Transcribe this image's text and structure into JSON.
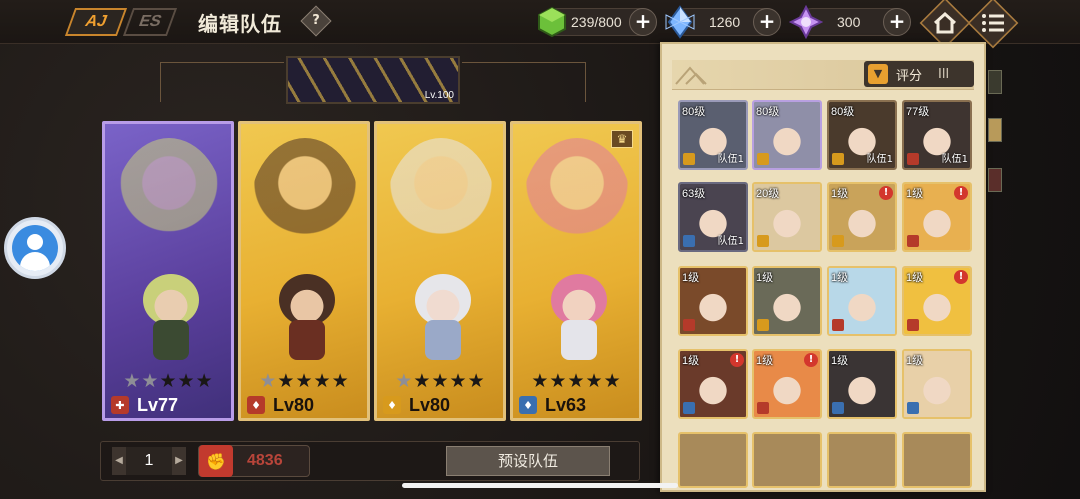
{
  "header": {
    "logo_mark_1": "AJ",
    "logo_mark_2": "ES",
    "title": "编辑队伍",
    "help_glyph": "?",
    "resources": [
      {
        "name": "stamina",
        "value": "239/800",
        "icon": "green-cube-icon",
        "color": "#6cc03a"
      },
      {
        "name": "crystal",
        "value": "1260",
        "icon": "blue-crystal-icon",
        "color": "#7db6ff"
      },
      {
        "name": "gem",
        "value": "300",
        "icon": "purple-gem-icon",
        "color": "#c692f2"
      }
    ],
    "plus_glyph": "+",
    "home_icon": "home-icon",
    "menu_icon": "menu-icon"
  },
  "boss_banner": {
    "level": "Lv.100"
  },
  "team_cards": [
    {
      "level": "Lv77",
      "stars_on": 2,
      "stars_total": 5,
      "theme": "purple",
      "role_color": "#b53a2a",
      "role_glyph": "✚",
      "hair": "#c9d07a",
      "skin": "#e9cdb0",
      "outfit": "#3b4a32"
    },
    {
      "level": "Lv80",
      "stars_on": 1,
      "stars_total": 5,
      "theme": "gold",
      "role_color": "#b53a2a",
      "role_glyph": "♦",
      "hair": "#4a3024",
      "skin": "#e9c6a5",
      "outfit": "#6a2f22"
    },
    {
      "level": "Lv80",
      "stars_on": 1,
      "stars_total": 5,
      "theme": "gold",
      "role_color": "#d79a1d",
      "role_glyph": "♦",
      "hair": "#e6e6ea",
      "skin": "#f0dbd0",
      "outfit": "#9aa9c8"
    },
    {
      "level": "Lv63",
      "stars_on": 0,
      "stars_total": 5,
      "theme": "gold",
      "role_color": "#3a6fb0",
      "role_glyph": "♦",
      "hair": "#e07aa0",
      "skin": "#f1d2c0",
      "outfit": "#e4e4ea",
      "crown": true
    }
  ],
  "star_glyph": "★",
  "crown_glyph": "♛",
  "bottom": {
    "page_prev": "◀",
    "page_number": "1",
    "page_next": "▶",
    "power_icon": "fist-icon",
    "power_glyph": "✊",
    "power_value": "4836",
    "preset_label": "预设队伍"
  },
  "roster": {
    "sort_label": "评分",
    "sort_filter_glyph": "▼",
    "sort_bars_glyph": "Ill",
    "slots": [
      {
        "level": "80级",
        "team": "队伍1",
        "border": "#9a9ab8",
        "bg": "#5a5f70",
        "cls": "#d79a1d"
      },
      {
        "level": "80级",
        "team": "",
        "border": "#b8a0e0",
        "bg": "#8f8fa8",
        "cls": "#d79a1d"
      },
      {
        "level": "80级",
        "team": "队伍1",
        "border": "#8a7050",
        "bg": "#4a3a2c",
        "cls": "#d79a1d"
      },
      {
        "level": "77级",
        "team": "队伍1",
        "border": "#8a7050",
        "bg": "#3e3430",
        "cls": "#b53a2a"
      },
      {
        "level": "63级",
        "team": "队伍1",
        "border": "#6a6a80",
        "bg": "#4a4450",
        "cls": "#3a6fb0"
      },
      {
        "level": "20级",
        "team": "",
        "border": "#e6c16a",
        "bg": "#dcc8a0",
        "cls": "#d79a1d"
      },
      {
        "level": "1级",
        "team": "",
        "border": "#e6c16a",
        "bg": "#c9a35a",
        "cls": "#d79a1d",
        "alert": true
      },
      {
        "level": "1级",
        "team": "",
        "border": "#e6c16a",
        "bg": "#e8b050",
        "cls": "#b53a2a",
        "alert": true
      },
      {
        "level": "1级",
        "team": "",
        "border": "#e6c16a",
        "bg": "#7a4a2a",
        "cls": "#b53a2a"
      },
      {
        "level": "1级",
        "team": "",
        "border": "#e6c16a",
        "bg": "#6a6a58",
        "cls": "#d79a1d"
      },
      {
        "level": "1级",
        "team": "",
        "border": "#e6c16a",
        "bg": "#b8d8e8",
        "cls": "#b53a2a"
      },
      {
        "level": "1级",
        "team": "",
        "border": "#e6c16a",
        "bg": "#f0c040",
        "cls": "#b53a2a",
        "alert": true
      },
      {
        "level": "1级",
        "team": "",
        "border": "#e6c16a",
        "bg": "#6a3a2a",
        "cls": "#3a6fb0",
        "alert": true
      },
      {
        "level": "1级",
        "team": "",
        "border": "#e6c16a",
        "bg": "#e88a48",
        "cls": "#b53a2a",
        "alert": true
      },
      {
        "level": "1级",
        "team": "",
        "border": "#e6c16a",
        "bg": "#3a3434",
        "cls": "#3a6fb0"
      },
      {
        "level": "1级",
        "team": "",
        "border": "#e6c16a",
        "bg": "#e8d0a8",
        "cls": "#3a6fb0"
      }
    ]
  }
}
